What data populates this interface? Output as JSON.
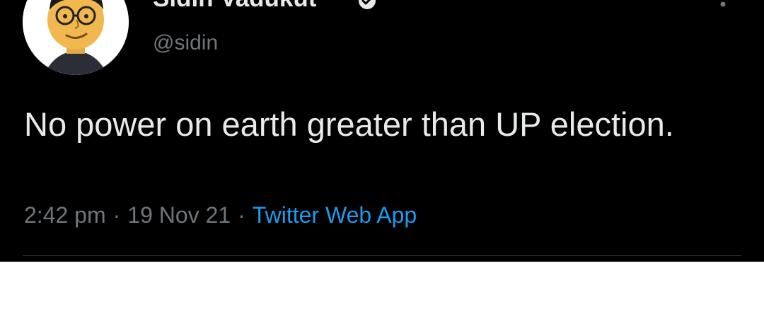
{
  "tweet": {
    "display_name": "Sidin Vadukut",
    "handle": "@sidin",
    "text": "No power on earth greater than UP election.",
    "time": "2:42 pm",
    "date": "19 Nov 21",
    "separator": "·",
    "source": "Twitter Web App"
  },
  "icons": {
    "verified": "verified-badge-icon",
    "more": "more-options-icon"
  },
  "colors": {
    "background": "#000000",
    "primary_text": "#e7e9ea",
    "secondary_text": "#71767b",
    "link": "#1d9bf0",
    "divider": "#2f3336"
  }
}
